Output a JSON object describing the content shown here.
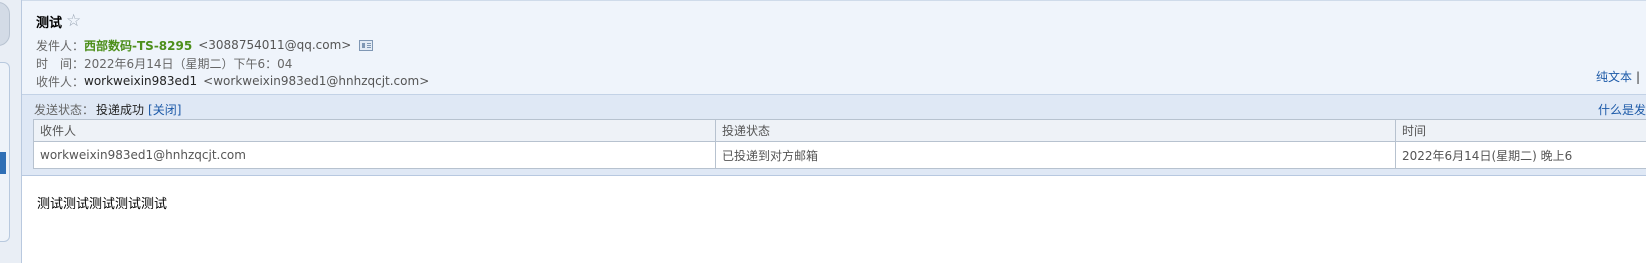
{
  "mail": {
    "subject": "测试",
    "sender_label": "发件人：",
    "sender_name": "西部数码-TS-8295",
    "sender_email": "<3088754011@qq.com>",
    "time_label": "时　间：",
    "time_value": "2022年6月14日（星期二）下午6：04",
    "recipient_label": "收件人：",
    "recipient_name": "workweixin983ed1",
    "recipient_email": "<workweixin983ed1@hnhzqcjt.com>",
    "plaintext_link": "纯文本",
    "plaintext_sep": "|",
    "body": "测试测试测试测试测试"
  },
  "delivery": {
    "status_label": "发送状态：",
    "status_value": "投递成功",
    "close_link": "[关闭]",
    "help_link": "什么是发",
    "columns": [
      "收件人",
      "投递状态",
      "时间"
    ],
    "rows": [
      {
        "recipient": "workweixin983ed1@hnhzqcjt.com",
        "status": "已投递到对方邮箱",
        "time": "2022年6月14日(星期二) 晚上6"
      }
    ]
  },
  "icons": {
    "star": "star-outline-icon",
    "contact_card": "contact-card-icon"
  },
  "colors": {
    "sender_name": "#4d8f1b",
    "link": "#1d5aa8",
    "header_bg": "#eff4fb",
    "status_bg": "#dfe8f5"
  }
}
